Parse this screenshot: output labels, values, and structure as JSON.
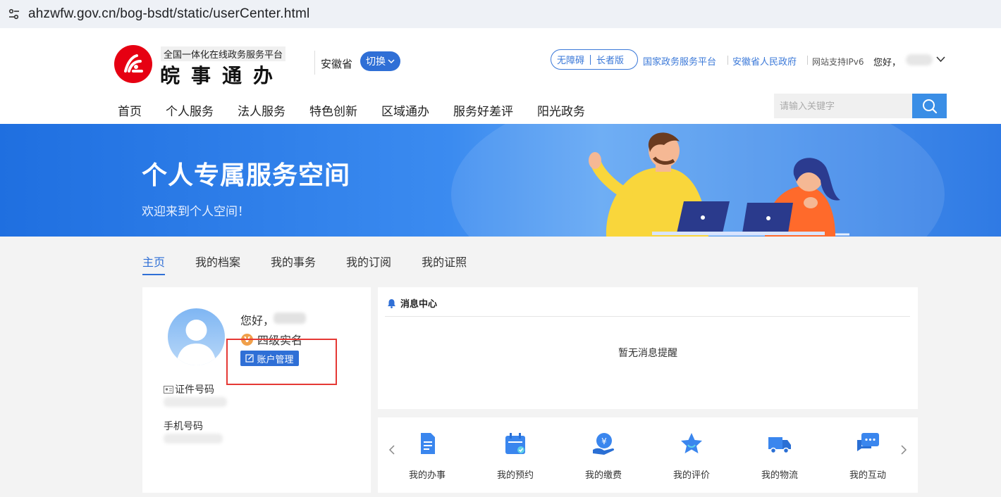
{
  "browser": {
    "url": "ahzwfw.gov.cn/bog-bsdt/static/userCenter.html"
  },
  "header": {
    "logo_sub": "全国一体化在线政务服务平台",
    "logo_main": "皖事通办",
    "province": "安徽省",
    "switch_label": "切换",
    "accessibility": "无障碍",
    "elder": "长者版",
    "links": [
      "国家政务服务平台",
      "安徽省人民政府"
    ],
    "ipv6": "网站支持IPv6",
    "greeting": "您好，"
  },
  "nav": [
    "首页",
    "个人服务",
    "法人服务",
    "特色创新",
    "区域通办",
    "服务好差评",
    "阳光政务"
  ],
  "search": {
    "placeholder": "请输入关键字"
  },
  "banner": {
    "title": "个人专属服务空间",
    "subtitle": "欢迎来到个人空间！"
  },
  "tabs": [
    "主页",
    "我的档案",
    "我的事务",
    "我的订阅",
    "我的证照"
  ],
  "profile": {
    "greeting": "您好，",
    "level": "四级实名",
    "level_badge": "V",
    "account_button": "账户管理",
    "id_label": "证件号码",
    "phone_label": "手机号码"
  },
  "messages": {
    "title": "消息中心",
    "empty": "暂无消息提醒"
  },
  "services": [
    {
      "label": "我的办事",
      "icon": "document-icon"
    },
    {
      "label": "我的预约",
      "icon": "calendar-icon"
    },
    {
      "label": "我的缴费",
      "icon": "payment-icon"
    },
    {
      "label": "我的评价",
      "icon": "star-icon"
    },
    {
      "label": "我的物流",
      "icon": "truck-icon"
    },
    {
      "label": "我的互动",
      "icon": "chat-icon"
    }
  ],
  "colors": {
    "primary": "#2f6fd6",
    "logo_red": "#e60012",
    "highlight": "#e53935"
  }
}
